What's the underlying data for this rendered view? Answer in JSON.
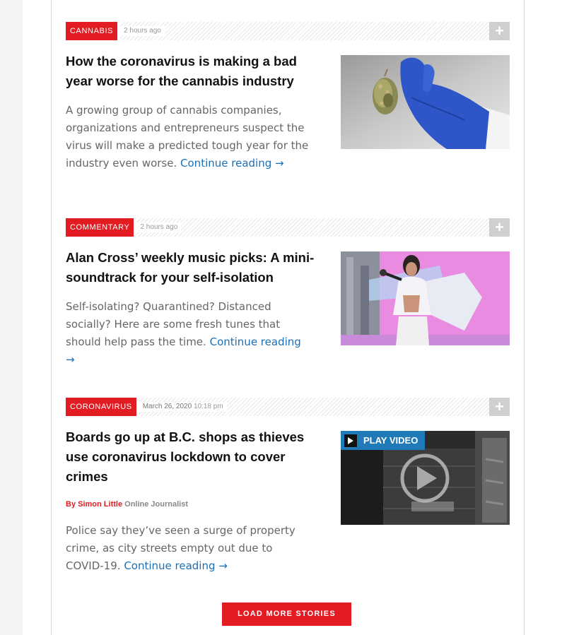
{
  "stories": [
    {
      "category": "CANNABIS",
      "date": "",
      "time": "2 hours ago",
      "plus_icon": "+",
      "headline": "How the coronavirus is making a bad year worse for the cannabis industry",
      "summary": "A growing group of cannabis companies, organizations and entrepreneurs suspect the virus will make a predicted tough year for the industry even worse.",
      "link_text": "Continue reading →",
      "thumbnail_icon": "gloved-hand-holding-cannabis-bud"
    },
    {
      "category": "COMMENTARY",
      "date": "",
      "time": "2 hours ago",
      "plus_icon": "+",
      "headline": "Alan Cross’ weekly music picks: A mini-soundtrack for your self-isolation",
      "summary": "Self-isolating? Quarantined? Distanced socially? Here are some fresh tunes that should help pass the time.",
      "link_text": "Continue reading →",
      "thumbnail_icon": "singer-performing-on-stage"
    },
    {
      "category": "CORONAVIRUS",
      "date": "March 26, 2020",
      "time": "10:18 pm",
      "plus_icon": "+",
      "headline": "Boards go up at B.C. shops as thieves use coronavirus lockdown to cover crimes",
      "byline_prefix": "By",
      "author": "Simon Little",
      "author_role": "Online Journalist",
      "summary": "Police say they’ve seen a surge of property crime, as city streets empty out due to COVID-19.",
      "link_text": "Continue reading →",
      "video_label": "PLAY VIDEO",
      "thumbnail_icon": "boarded-up-storefront-video"
    }
  ],
  "load_more_label": "LOAD MORE STORIES",
  "colors": {
    "accent_red": "#e31b23",
    "link_blue": "#1c6fb5",
    "video_badge_blue": "#1f7ab7",
    "plus_grey": "#cfcfcf"
  }
}
